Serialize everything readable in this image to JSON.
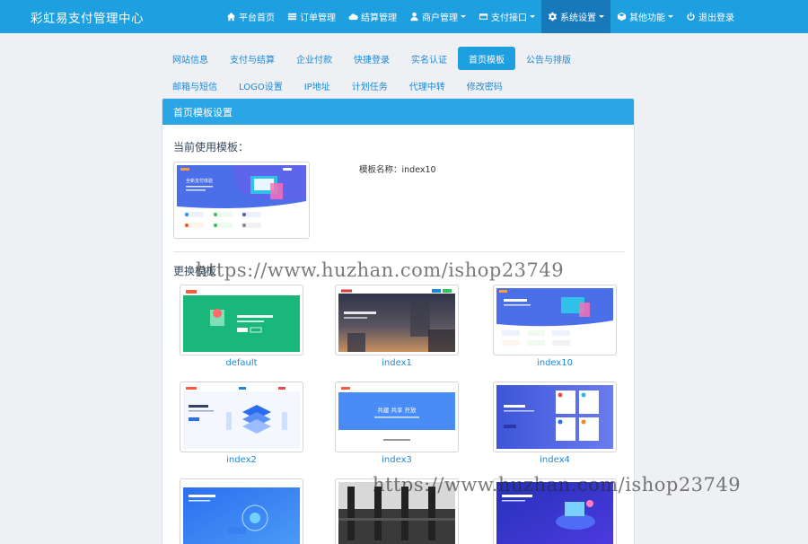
{
  "app": {
    "brand": "彩虹易支付管理中心"
  },
  "nav": {
    "items": [
      {
        "label": "平台首页",
        "icon": "home-icon"
      },
      {
        "label": "订单管理",
        "icon": "list-icon"
      },
      {
        "label": "结算管理",
        "icon": "cloud-icon"
      },
      {
        "label": "商户管理",
        "icon": "user-icon",
        "dropdown": true
      },
      {
        "label": "支付接口",
        "icon": "card-icon",
        "dropdown": true
      },
      {
        "label": "系统设置",
        "icon": "gear-icon",
        "dropdown": true,
        "active": true
      },
      {
        "label": "其他功能",
        "icon": "cube-icon",
        "dropdown": true
      },
      {
        "label": "退出登录",
        "icon": "power-icon"
      }
    ]
  },
  "tabs": {
    "row1": [
      "网站信息",
      "支付与结算",
      "企业付款",
      "快捷登录",
      "实名认证",
      "首页模板",
      "公告与排版"
    ],
    "row2": [
      "邮箱与短信",
      "LOGO设置",
      "IP地址",
      "计划任务",
      "代理中转",
      "修改密码"
    ],
    "active": "首页模板"
  },
  "panel": {
    "heading": "首页模板设置",
    "current_title": "当前使用模板：",
    "template_name": "模板名称：index10",
    "change_title": "更换模板"
  },
  "templates": [
    {
      "name": "default"
    },
    {
      "name": "index1"
    },
    {
      "name": "index10"
    },
    {
      "name": "index2"
    },
    {
      "name": "index3"
    },
    {
      "name": "index4"
    },
    {
      "name": ""
    },
    {
      "name": ""
    },
    {
      "name": ""
    }
  ],
  "thumb_text": {
    "index10_title": "全新支付体验",
    "index3_title": "共建 共享 开放"
  },
  "watermark": "https://www.huzhan.com/ishop23749",
  "colors": {
    "nav_bg": "#1e9fe0",
    "nav_active": "#1779ba",
    "link": "#1e88d8",
    "panel_heading": "#2aa6e6"
  }
}
